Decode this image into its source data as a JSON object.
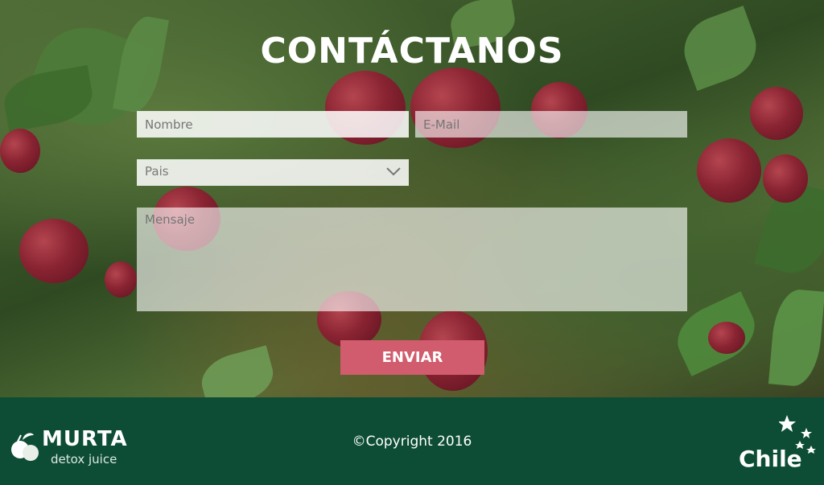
{
  "hero": {
    "title": "CONTÁCTANOS"
  },
  "form": {
    "name_placeholder": "Nombre",
    "email_placeholder": "E-Mail",
    "country_selected": "Pais",
    "message_placeholder": "Mensaje",
    "submit_label": "ENVIAR"
  },
  "footer": {
    "brand_name": "MURTA",
    "brand_tagline": "detox juice",
    "copyright": "©Copyright 2016",
    "partner_logo_text": "Chile"
  },
  "colors": {
    "submit_button": "#d05c6d",
    "footer_bg": "#0d4d36"
  },
  "icons": [
    "fruit-logo-icon",
    "chevron-down-icon",
    "stars-icon"
  ]
}
